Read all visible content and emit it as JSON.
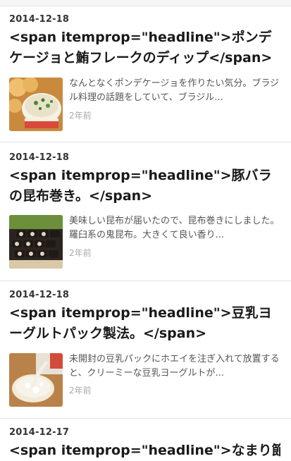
{
  "articles": [
    {
      "date": "2014-12-18",
      "title": "<span itemprop=\"headline\">ポンデケージョと鮪フレークのディップ</span>",
      "excerpt": "なんとなくポンデケージョを作りたい気分。ブラジル料理の話題をしていて、ブラジル...",
      "age": "2年前",
      "thumbnail": "bread-and-tuna-dip-photo"
    },
    {
      "date": "2014-12-18",
      "title": "<span itemprop=\"headline\">豚バラの昆布巻き。</span>",
      "excerpt": "美味しい昆布が届いたので、昆布巻きにしました。羅臼系の鬼昆布。大きくて良い香り...",
      "age": "2年前",
      "thumbnail": "pork-kombu-rolls-photo"
    },
    {
      "date": "2014-12-18",
      "title": "<span itemprop=\"headline\">豆乳ヨーグルトパック製法。</span>",
      "excerpt": "未開封の豆乳パックにホエイを注ぎ入れて放置すると、クリーミーな豆乳ヨーグルトが...",
      "age": "2年前",
      "thumbnail": "soy-yogurt-photo"
    },
    {
      "date": "2014-12-17",
      "title": "<span itemprop=\"headline\">なまり節と"
    }
  ]
}
